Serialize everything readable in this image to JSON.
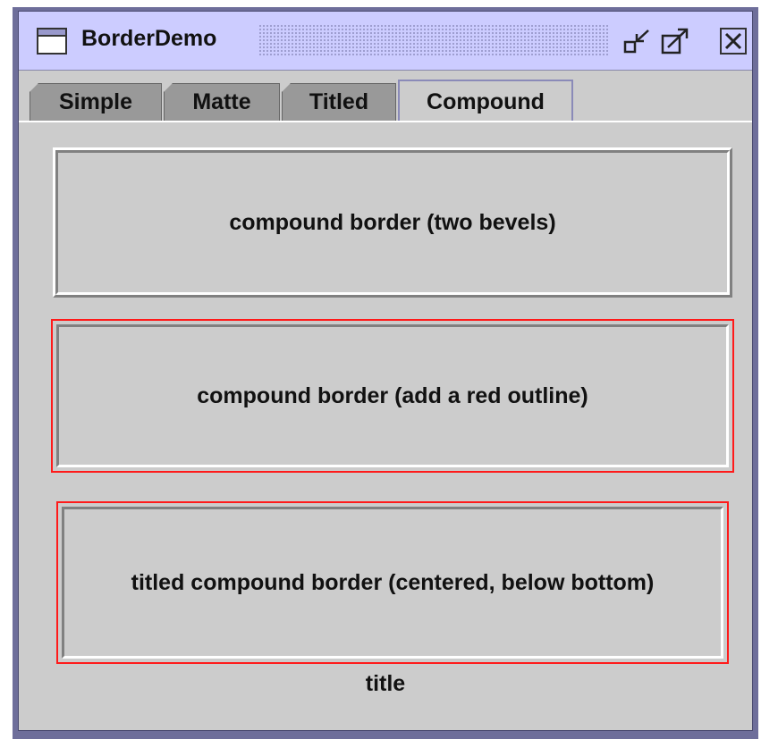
{
  "window": {
    "title": "BorderDemo",
    "controls": [
      "minimize-icon",
      "maximize-icon",
      "close-icon"
    ],
    "accent": "#ccccff"
  },
  "tabs": [
    {
      "label": "Simple",
      "active": false
    },
    {
      "label": "Matte",
      "active": false
    },
    {
      "label": "Titled",
      "active": false
    },
    {
      "label": "Compound",
      "active": true
    }
  ],
  "panels": {
    "two_bevels": "compound border (two bevels)",
    "red_outline": "compound border (add a red outline)",
    "titled": "titled compound border (centered, below bottom)",
    "titled_caption": "title"
  },
  "colors": {
    "outline": "#ff1a1a",
    "background": "#cccccc"
  }
}
